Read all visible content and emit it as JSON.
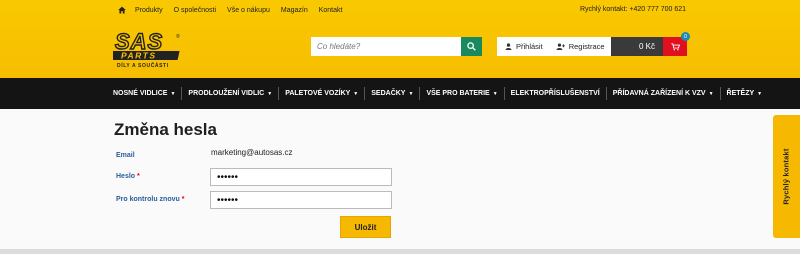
{
  "topnav": {
    "links": [
      "Produkty",
      "O společnosti",
      "Vše o nákupu",
      "Magazín",
      "Kontakt"
    ],
    "quick_contact": "Rychlý kontakt: +420 777 700 621"
  },
  "search": {
    "placeholder": "Co hledáte?"
  },
  "account": {
    "login": "Přihlásit",
    "register": "Registrace"
  },
  "cart": {
    "total": "0 Kč",
    "count": "0"
  },
  "categories": [
    {
      "label": "Nosné vidlice",
      "has_dropdown": true
    },
    {
      "label": "Prodloužení vidlic",
      "has_dropdown": true
    },
    {
      "label": "Paletové vozíky",
      "has_dropdown": true
    },
    {
      "label": "Sedačky",
      "has_dropdown": true
    },
    {
      "label": "Vše pro baterie",
      "has_dropdown": true
    },
    {
      "label": "Elektropříslušenství",
      "has_dropdown": false
    },
    {
      "label": "Přídavná zařízení k VZV",
      "has_dropdown": true
    },
    {
      "label": "Řetězy",
      "has_dropdown": true
    }
  ],
  "form": {
    "title": "Změna hesla",
    "email_label": "Email",
    "email_value": "marketing@autosas.cz",
    "password_label": "Heslo",
    "password_value": "••••••",
    "confirm_label": "Pro kontrolu znovu",
    "confirm_value": "••••••",
    "required_mark": "*",
    "save_label": "Uložit"
  },
  "side_tab": {
    "label": "Rychlý kontakt"
  },
  "colors": {
    "header_yellow": "#f7c200",
    "nav_black": "#141414",
    "search_green": "#1a8a5e",
    "cart_red": "#e0101e",
    "badge_blue": "#1a8ab8",
    "label_blue": "#2a5d9a",
    "button_yellow": "#f6b800"
  },
  "icons": {
    "home": "home-icon",
    "search": "search-icon",
    "user": "user-icon",
    "register": "add-user-icon",
    "cart": "cart-icon"
  }
}
